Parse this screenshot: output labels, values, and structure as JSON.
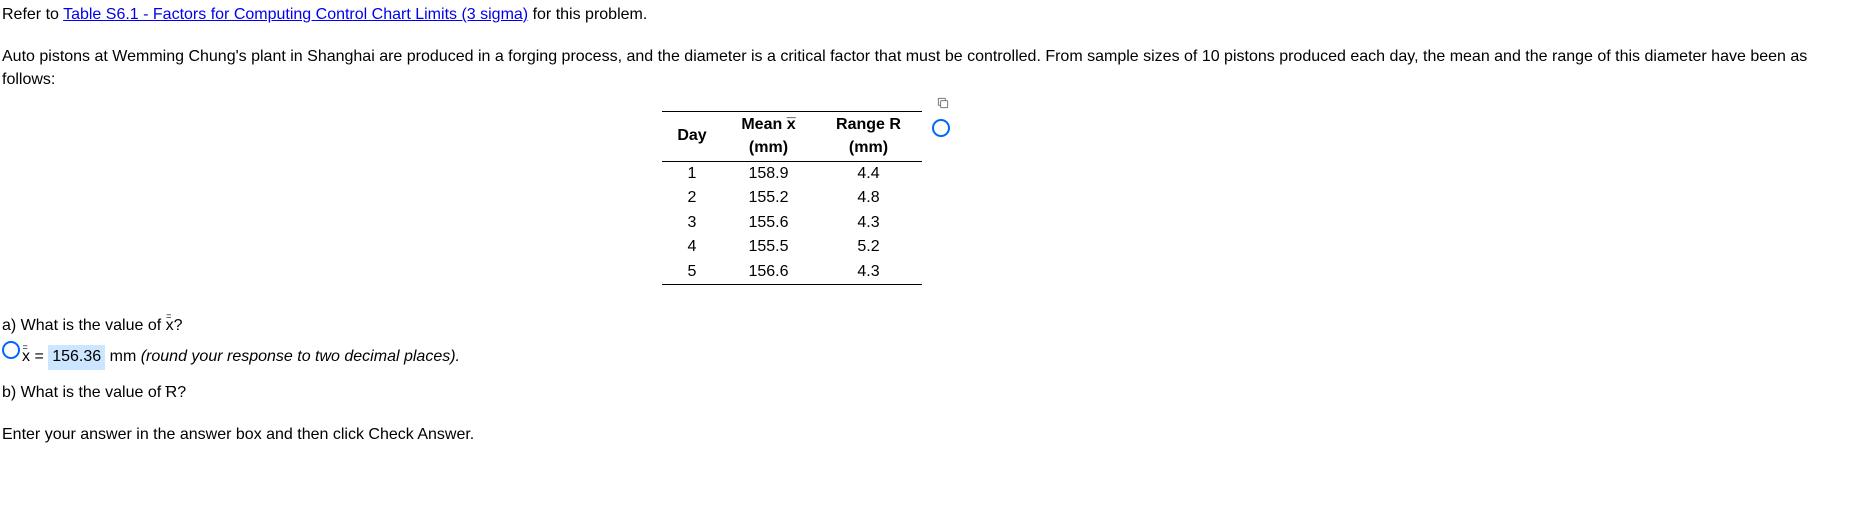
{
  "intro": {
    "refer": "Refer to ",
    "link": "Table S6.1 - Factors for Computing Control Chart Limits (3 sigma)",
    "after_link": " for this problem.",
    "paragraph": "Auto pistons at Wemming Chung's plant in Shanghai are produced in a forging process, and the diameter is a critical factor that must be controlled. From sample sizes of 10 pistons produced each day, the mean and the range of this diameter have been as follows:"
  },
  "table": {
    "headers": {
      "day": "Day",
      "mean_top": "Mean x",
      "mean_bot": "(mm)",
      "range_top": "Range R",
      "range_bot": "(mm)"
    },
    "rows": [
      {
        "day": "1",
        "mean": "158.9",
        "range": "4.4"
      },
      {
        "day": "2",
        "mean": "155.2",
        "range": "4.8"
      },
      {
        "day": "3",
        "mean": "155.6",
        "range": "4.3"
      },
      {
        "day": "4",
        "mean": "155.5",
        "range": "5.2"
      },
      {
        "day": "5",
        "mean": "156.6",
        "range": "4.3"
      }
    ]
  },
  "qa": {
    "q_a_prefix": "a) What is the value of ",
    "q_a_var": "x",
    "q_a_suffix": "?",
    "ans_prefix": "x",
    "ans_eq": " = ",
    "ans_value": "156.36",
    "ans_unit": " mm ",
    "ans_hint": "(round your response to two decimal places).",
    "q_b_prefix": "b) What is the value of ",
    "q_b_var": "R",
    "q_b_suffix": "?"
  },
  "footer": "Enter your answer in the answer box and then click Check Answer."
}
